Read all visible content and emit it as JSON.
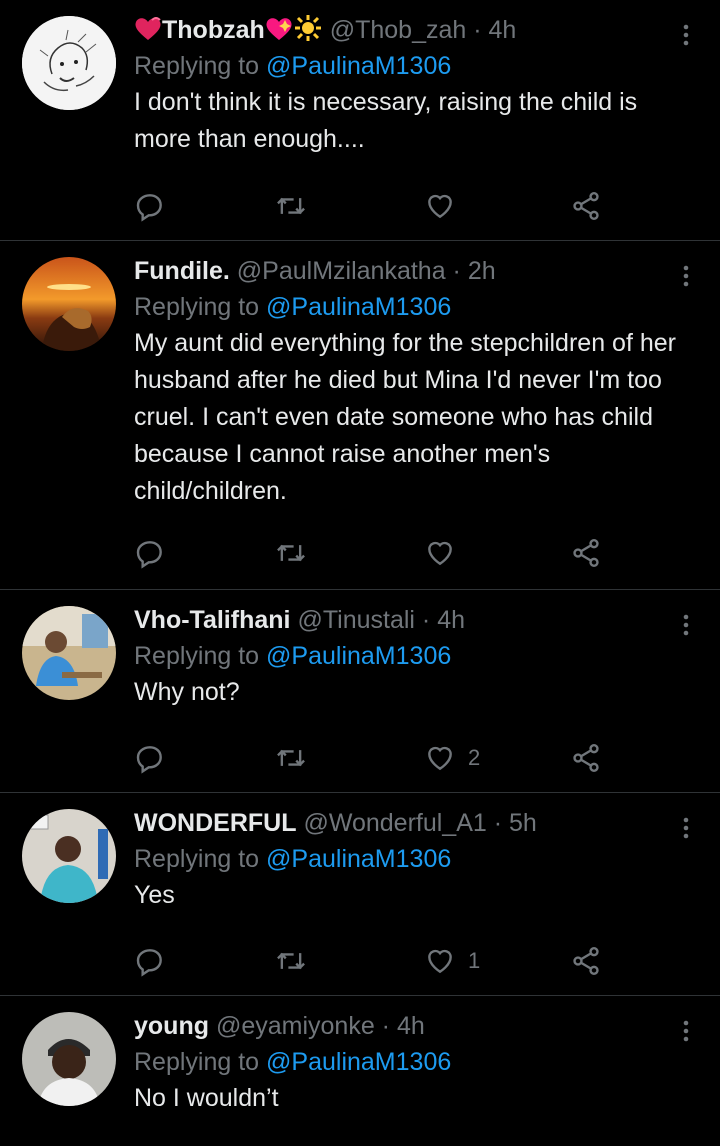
{
  "replies": [
    {
      "name": "Thobzah",
      "handle": "@Thob_zah",
      "time": "4h",
      "replying_prefix": "Replying to ",
      "replying_to": "@PaulinaM1306",
      "text": "I don't think it is necessary, raising the child is more than enough....",
      "likes": "",
      "avatar_icon": "sketch-drawing-avatar"
    },
    {
      "name": "Fundile.",
      "handle": "@PaulMzilankatha",
      "time": "2h",
      "replying_prefix": "Replying to ",
      "replying_to": "@PaulinaM1306",
      "text": "My aunt did everything for the stepchildren of her husband after he died but Mina I'd never I'm too cruel. I can't even date someone who has child because I cannot raise another men's child/children.",
      "likes": "",
      "avatar_icon": "lion-sunset-avatar"
    },
    {
      "name": "Vho-Talifhani",
      "handle": "@Tinustali",
      "time": "4h",
      "replying_prefix": "Replying to ",
      "replying_to": "@PaulinaM1306",
      "text": "Why not?",
      "likes": "2",
      "avatar_icon": "man-at-desk-avatar"
    },
    {
      "name": "WONDERFUL",
      "handle": "@Wonderful_A1",
      "time": "5h",
      "replying_prefix": "Replying to ",
      "replying_to": "@PaulinaM1306",
      "text": "Yes",
      "likes": "1",
      "avatar_icon": "man-blue-shirt-avatar"
    },
    {
      "name": "young",
      "handle": "@eyamiyonke",
      "time": "4h",
      "replying_prefix": "Replying to ",
      "replying_to": "@PaulinaM1306",
      "text": "No I wouldn’t",
      "likes": "",
      "avatar_icon": "man-beanie-avatar"
    }
  ],
  "colors": {
    "background": "#000000",
    "text": "#e7e9ea",
    "muted": "#71767b",
    "accent": "#1d9bf0",
    "divider": "#2f3336"
  }
}
